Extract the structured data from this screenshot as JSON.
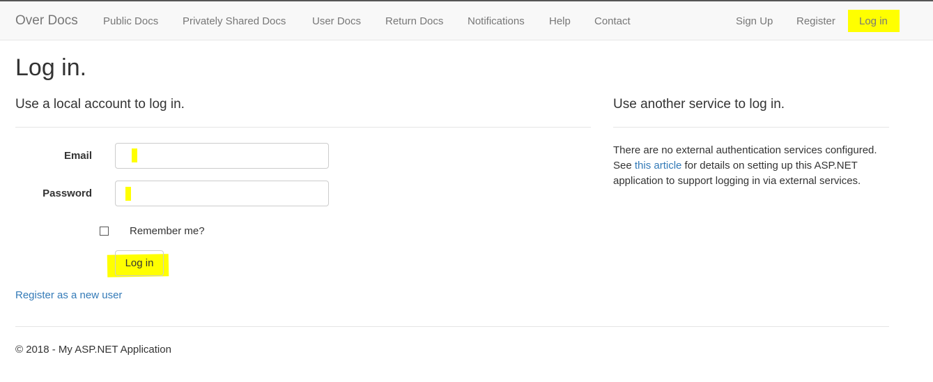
{
  "navbar": {
    "brand": "Over Docs",
    "left_items": [
      "Public Docs",
      "Privately Shared Docs",
      "User Docs",
      "Return Docs",
      "Notifications",
      "Help",
      "Contact"
    ],
    "right_items": [
      "Sign Up",
      "Register",
      "Log in"
    ]
  },
  "page": {
    "title": "Log in.",
    "local_heading": "Use a local account to log in.",
    "service_heading": "Use another service to log in."
  },
  "form": {
    "email_label": "Email",
    "email_value": "",
    "password_label": "Password",
    "password_value": "",
    "remember_label": "Remember me?",
    "submit_label": "Log in"
  },
  "register_link": "Register as a new user",
  "external": {
    "text_before": "There are no external authentication services configured. See ",
    "link_text": "this article",
    "text_after": " for details on setting up this ASP.NET application to support logging in via external services."
  },
  "footer": "© 2018 - My ASP.NET Application",
  "colors": {
    "highlight": "#ffff00",
    "link": "#337ab7",
    "nav_text": "#777777",
    "navbar_bg": "#f8f8f8"
  }
}
